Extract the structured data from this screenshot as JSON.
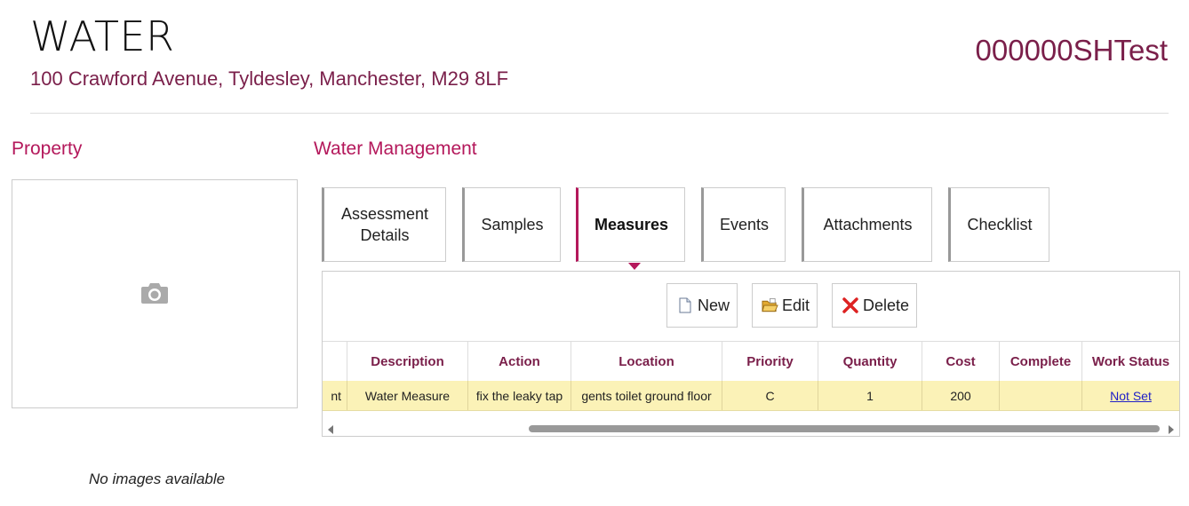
{
  "header": {
    "title": "WATER",
    "address": "100 Crawford Avenue, Tyldesley, Manchester, M29 8LF",
    "account": "000000SHTest"
  },
  "property": {
    "title": "Property",
    "no_images": "No images available",
    "icon": "camera-icon"
  },
  "water_management": {
    "title": "Water Management",
    "tabs": [
      {
        "label": "Assessment Details",
        "active": false
      },
      {
        "label": "Samples",
        "active": false
      },
      {
        "label": "Measures",
        "active": true
      },
      {
        "label": "Events",
        "active": false
      },
      {
        "label": "Attachments",
        "active": false
      },
      {
        "label": "Checklist",
        "active": false
      }
    ],
    "toolbar": {
      "new_label": "New",
      "edit_label": "Edit",
      "delete_label": "Delete"
    },
    "table": {
      "headers": [
        "",
        "Description",
        "Action",
        "Location",
        "Priority",
        "Quantity",
        "Cost",
        "Complete",
        "Work Status"
      ],
      "rows": [
        [
          "nt",
          "Water Measure",
          "fix the leaky tap",
          "gents toilet ground floor",
          "C",
          "1",
          "200",
          "",
          "Not Set"
        ]
      ]
    },
    "colors": {
      "accent": "#b4185b",
      "header_text": "#7a1f4a",
      "row_highlight": "#fbf2b7"
    }
  }
}
